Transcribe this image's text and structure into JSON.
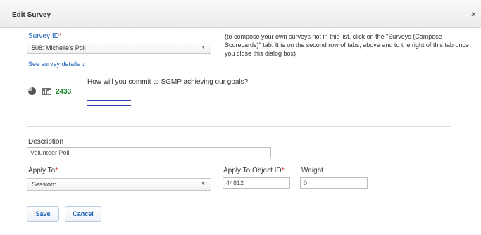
{
  "dialog": {
    "title": "Edit Survey",
    "close_glyph": "×"
  },
  "survey": {
    "label": "Survey ID",
    "required_mark": "*",
    "selected": "508: Michelle's Poll",
    "details_link": "See survey details ↓",
    "note": "(to compose your own surveys not in this list, click on the \"Surveys (Compose Scorecards)\" tab. It is on the second row of tabs, above and to the right of this tab once you close this dialog box)",
    "response_count": "2433",
    "question": "How will you commit to SGMP achieving our goals?",
    "icons": [
      "pie-chart-icon",
      "bar-chart-icon"
    ]
  },
  "description": {
    "label": "Description",
    "value": "Volunteer Poll"
  },
  "apply_to": {
    "label": "Apply To",
    "required_mark": "*",
    "selected": "Session:"
  },
  "apply_to_object_id": {
    "label": "Apply To Object ID",
    "required_mark": "*",
    "value": "44812"
  },
  "weight": {
    "label": "Weight",
    "value": "0"
  },
  "buttons": {
    "save": "Save",
    "cancel": "Cancel"
  },
  "colors": {
    "link": "#1a5fb4",
    "required": "#e02020",
    "count": "#1e8a2e"
  }
}
